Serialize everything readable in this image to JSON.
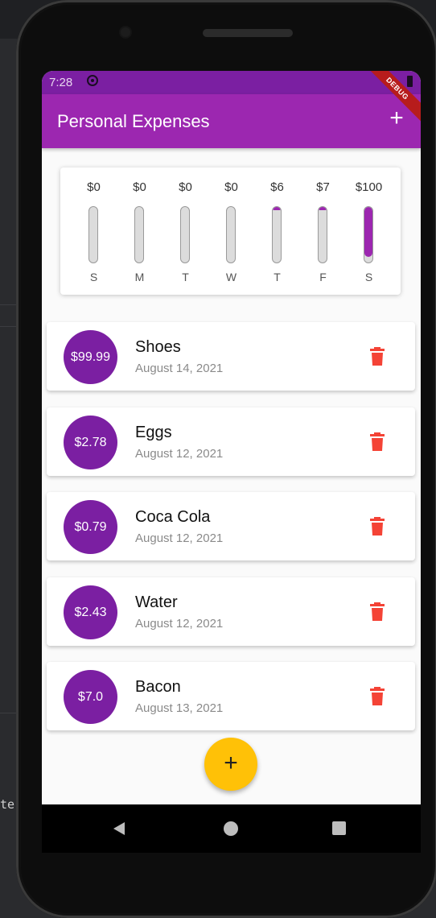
{
  "status_bar": {
    "time": "7:28"
  },
  "app_bar": {
    "title": "Personal Expenses",
    "add_icon": "+",
    "debug_label": "DEBUG"
  },
  "chart_data": {
    "type": "bar",
    "categories": [
      "S",
      "M",
      "T",
      "W",
      "T",
      "F",
      "S"
    ],
    "labels": [
      "$0",
      "$0",
      "$0",
      "$0",
      "$6",
      "$7",
      "$100"
    ],
    "values": [
      0,
      0,
      0,
      0,
      6,
      7,
      100
    ],
    "fill_fractions": [
      0,
      0,
      0,
      0,
      0.04,
      0.05,
      0.9
    ],
    "bar_color": "#9c27b0"
  },
  "transactions": [
    {
      "amount": "$99.99",
      "title": "Shoes",
      "date": "August 14, 2021"
    },
    {
      "amount": "$2.78",
      "title": "Eggs",
      "date": "August 12, 2021"
    },
    {
      "amount": "$0.79",
      "title": "Coca Cola",
      "date": "August 12, 2021"
    },
    {
      "amount": "$2.43",
      "title": "Water",
      "date": "August 12, 2021"
    },
    {
      "amount": "$7.0",
      "title": "Bacon",
      "date": "August 13, 2021"
    }
  ],
  "fab": {
    "label": "+"
  },
  "ide": {
    "fragment": "te"
  },
  "colors": {
    "primary": "#9c27b0",
    "primary_dark": "#7b1fa2",
    "accent": "#ffc107",
    "delete": "#f44336"
  }
}
